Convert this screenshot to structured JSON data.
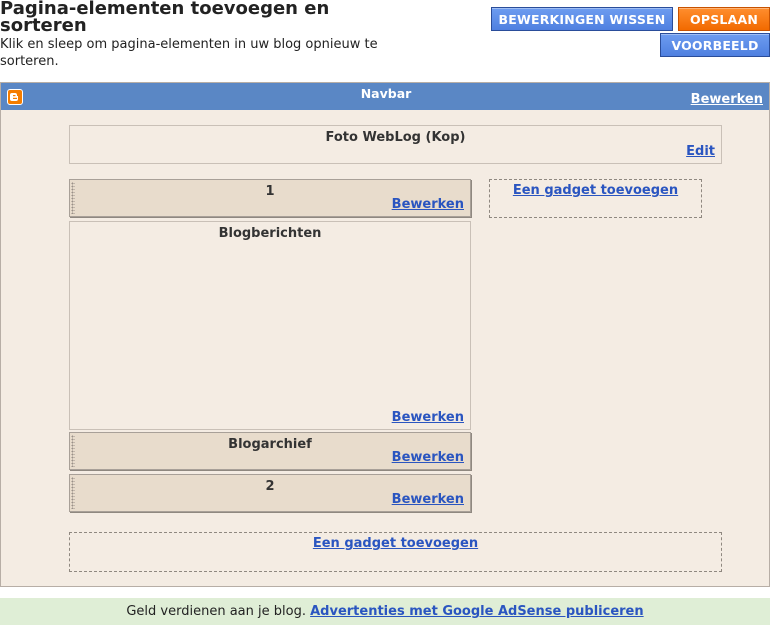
{
  "header": {
    "title": "Pagina-elementen toevoegen en sorteren",
    "subtitle": "Klik en sleep om pagina-elementen in uw blog opnieuw te sorteren."
  },
  "toolbar": {
    "clear_label": "BEWERKINGEN WISSEN",
    "save_label": "OPSLAAN",
    "preview_label": "VOORBEELD"
  },
  "navbar": {
    "title": "Navbar",
    "edit_label": "Bewerken",
    "icon": "blogger-icon"
  },
  "header_widget": {
    "title": "Foto WebLog (Kop)",
    "edit_label": "Edit"
  },
  "main_column": {
    "widgets": [
      {
        "title": "1",
        "edit_label": "Bewerken"
      },
      {
        "title": "Blogberichten",
        "edit_label": "Bewerken"
      },
      {
        "title": "Blogarchief",
        "edit_label": "Bewerken"
      },
      {
        "title": "2",
        "edit_label": "Bewerken"
      }
    ]
  },
  "sidebar": {
    "add_gadget_label": "Een gadget toevoegen"
  },
  "bottom": {
    "add_gadget_label": "Een gadget toevoegen"
  },
  "footer": {
    "text": "Geld verdienen aan je blog.",
    "link_label": "Advertenties met Google AdSense publiceren"
  },
  "colors": {
    "navbar": "#5a87c5",
    "layout_bg": "#f4ece3",
    "widget_bg": "#e8dccc",
    "link": "#2a55c0",
    "save_button": "#f26a00",
    "blue_button": "#4f80e0",
    "footer_bg": "#dfeed6"
  }
}
